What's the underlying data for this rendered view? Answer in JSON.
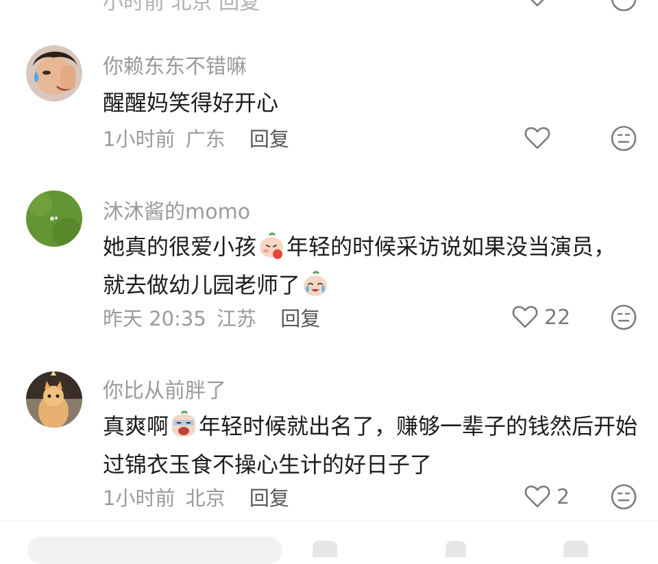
{
  "top_partial": {
    "meta_text": "小时前 北京 回复"
  },
  "comments": [
    {
      "username": "你赖东东不错嘛",
      "text": "醒醒妈笑得好开心",
      "time": "1小时前",
      "location": "广东",
      "reply": "回复",
      "likes": ""
    },
    {
      "username": "沐沐酱的momo",
      "text_part1": "她真的很爱小孩",
      "text_part2": "年轻的时候采访说如果没当演员，",
      "text_part3": "就去做幼儿园老师了",
      "time": "昨天 20:35",
      "location": "江苏",
      "reply": "回复",
      "likes": "22"
    },
    {
      "username": "你比从前胖了",
      "text_part1": "真爽啊",
      "text_part2": "年轻时候就出名了，赚够一辈子的钱然后开始过锦衣玉食不操心生计的好日子了",
      "time": "1小时前",
      "location": "北京",
      "reply": "回复",
      "likes": "2"
    }
  ],
  "icons": {
    "like": "heart-outline-icon",
    "dislike": "neutral-face-icon",
    "emoji_shy": "blushing-shy-emoji",
    "emoji_cry": "crying-laughing-emoji",
    "emoji_shock": "screaming-emoji"
  },
  "colors": {
    "text_primary": "#1b1b1b",
    "text_secondary": "#9a9a9a",
    "reply": "#555555",
    "icon": "#7a7a7a"
  }
}
